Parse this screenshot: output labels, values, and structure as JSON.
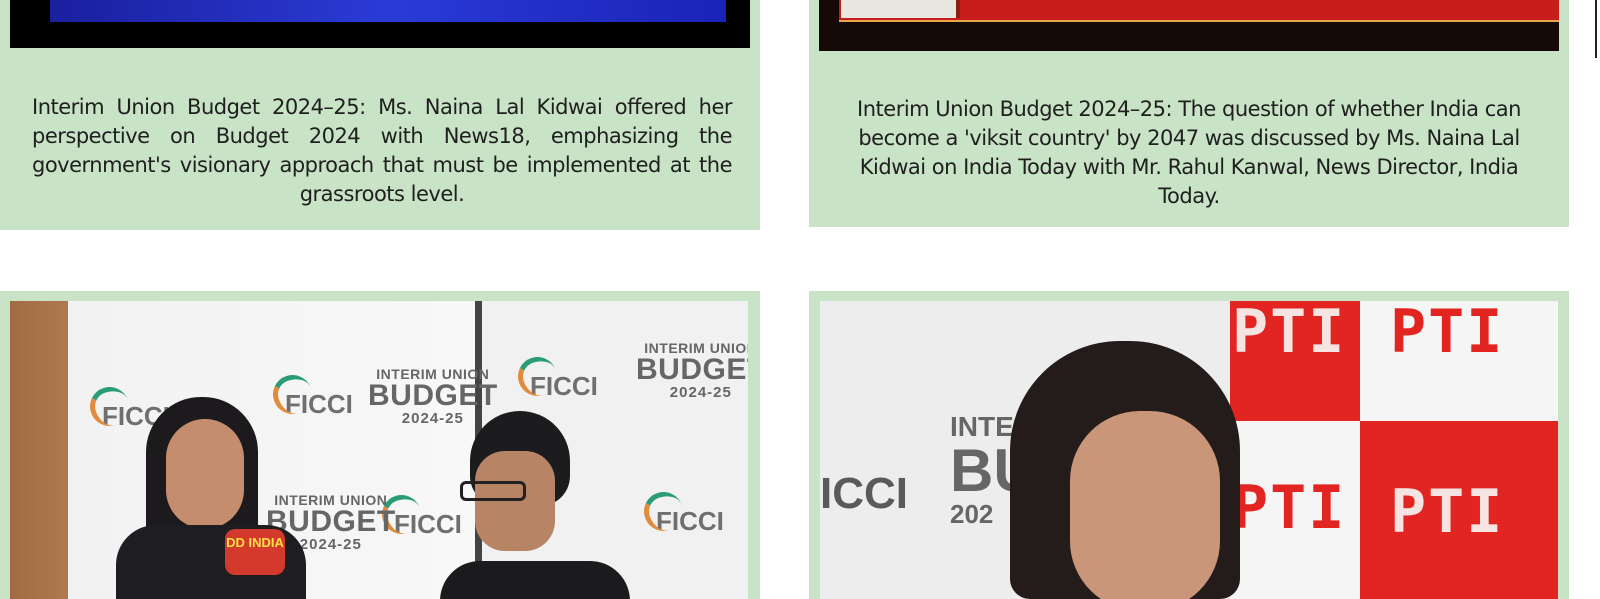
{
  "cards": [
    {
      "caption": "Interim Union Budget 2024–25: Ms. Naina Lal Kidwai offered her perspective on Budget 2024 with News18, emphasizing the government's visionary approach that must be implemented at the grassroots level."
    },
    {
      "caption": "Interim Union Budget 2024–25: The question of whether India can become a 'viksit country' by 2047 was discussed by Ms. Naina Lal Kidwai on India Today with Mr. Rahul Kanwal, News Director, India Today."
    }
  ],
  "photo3": {
    "ficci_logo": "FICCI",
    "budget_line1": "INTERIM UNION",
    "budget_line2": "BUDGET",
    "budget_line3": "2024-25",
    "mic_label": "DD INDIA"
  },
  "photo4": {
    "ficci_logo": "ICCI",
    "budget_line1": "INTERIM",
    "budget_line2": "BUD",
    "budget_line3": "202",
    "pti_logo": "PTI"
  },
  "colors": {
    "card_bg": "#c8e3c5",
    "caption_text": "#1f1f1f"
  }
}
